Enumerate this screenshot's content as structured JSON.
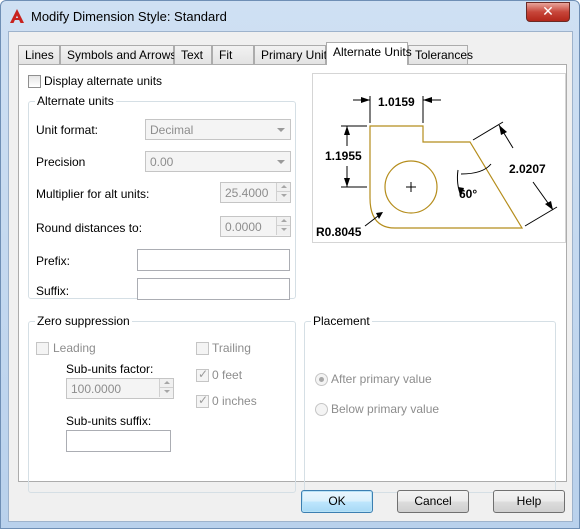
{
  "window": {
    "title": "Modify Dimension Style: Standard",
    "close_glyph": "✕",
    "icon": "autocad-a-icon"
  },
  "tabs": [
    {
      "label": "Lines",
      "active": false
    },
    {
      "label": "Symbols and Arrows",
      "active": false
    },
    {
      "label": "Text",
      "active": false
    },
    {
      "label": "Fit",
      "active": false
    },
    {
      "label": "Primary Units",
      "active": false
    },
    {
      "label": "Alternate Units",
      "active": true
    },
    {
      "label": "Tolerances",
      "active": false
    }
  ],
  "display_alt": {
    "label": "Display alternate units",
    "checked": false
  },
  "alt_units": {
    "group_label": "Alternate units",
    "unit_format_label": "Unit format:",
    "unit_format_value": "Decimal",
    "precision_label": "Precision",
    "precision_value": "0.00",
    "multiplier_label": "Multiplier for alt units:",
    "multiplier_value": "25.4000",
    "round_label": "Round distances  to:",
    "round_value": "0.0000",
    "prefix_label": "Prefix:",
    "prefix_value": "",
    "suffix_label": "Suffix:",
    "suffix_value": ""
  },
  "zero_suppression": {
    "group_label": "Zero suppression",
    "leading_label": "Leading",
    "leading_checked": false,
    "trailing_label": "Trailing",
    "trailing_checked": false,
    "subunits_factor_label": "Sub-units factor:",
    "subunits_factor_value": "100.0000",
    "feet_label": "0 feet",
    "feet_checked": true,
    "inches_label": "0 inches",
    "inches_checked": true,
    "subunits_suffix_label": "Sub-units suffix:",
    "subunits_suffix_value": ""
  },
  "placement": {
    "group_label": "Placement",
    "after_label": "After primary value",
    "after_selected": true,
    "below_label": "Below primary value",
    "below_selected": false
  },
  "preview": {
    "dim_top": "1.0159",
    "dim_left": "1.1955",
    "dim_right": "2.0207",
    "dim_angle": "60°",
    "dim_radius": "R0.8045",
    "part_color": "#b58d1c"
  },
  "buttons": {
    "ok": "OK",
    "cancel": "Cancel",
    "help": "Help"
  }
}
